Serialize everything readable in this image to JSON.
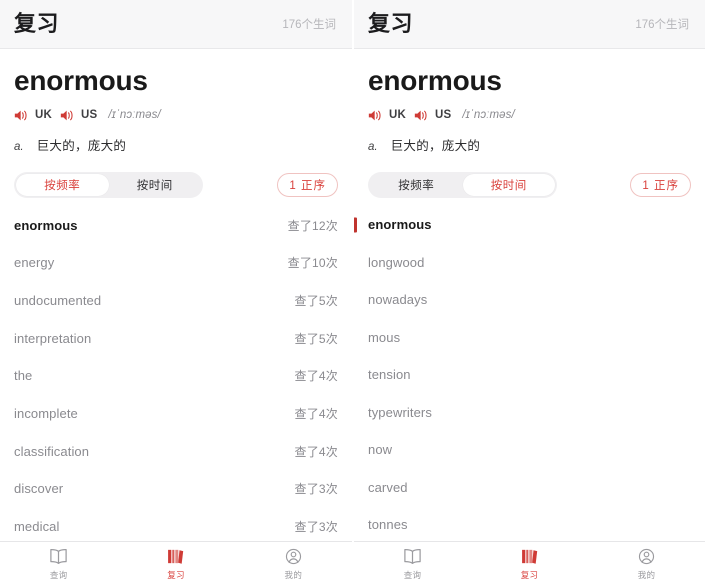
{
  "colors": {
    "accent_red": "#d9413c",
    "icon_red": "#cf3b36",
    "header_bg": "#f7f7f8",
    "muted_text": "#8a8a8f",
    "primary_text": "#1a1a1a"
  },
  "panels": [
    {
      "id": "left",
      "header": {
        "title": "复习",
        "count": "176个生词"
      },
      "word_card": {
        "headword": "enormous",
        "uk_label": "UK",
        "us_label": "US",
        "ipa": "/ɪˈnɔːməs/",
        "pos": "a.",
        "definition": "巨大的，庞大的",
        "uk_speaker_icon": "speaker-icon",
        "us_speaker_icon": "speaker-icon"
      },
      "controls": {
        "segments": [
          {
            "label": "按频率",
            "active": true
          },
          {
            "label": "按时间",
            "active": false
          }
        ],
        "order_pill": "1 正序"
      },
      "list": {
        "show_counts": true,
        "items": [
          {
            "word": "enormous",
            "count": "查了12次",
            "current": true,
            "marked": false
          },
          {
            "word": "energy",
            "count": "查了10次",
            "current": false,
            "marked": false
          },
          {
            "word": "undocumented",
            "count": "查了5次",
            "current": false,
            "marked": false
          },
          {
            "word": "interpretation",
            "count": "查了5次",
            "current": false,
            "marked": false
          },
          {
            "word": "the",
            "count": "查了4次",
            "current": false,
            "marked": false
          },
          {
            "word": "incomplete",
            "count": "查了4次",
            "current": false,
            "marked": false
          },
          {
            "word": "classification",
            "count": "查了4次",
            "current": false,
            "marked": false
          },
          {
            "word": "discover",
            "count": "查了3次",
            "current": false,
            "marked": false
          },
          {
            "word": "medical",
            "count": "查了3次",
            "current": false,
            "marked": false
          }
        ]
      },
      "tabbar": [
        {
          "label": "查询",
          "icon": "book-open-icon",
          "active": false
        },
        {
          "label": "复习",
          "icon": "books-shelf-icon",
          "active": true
        },
        {
          "label": "我的",
          "icon": "person-circle-icon",
          "active": false
        }
      ]
    },
    {
      "id": "right",
      "header": {
        "title": "复习",
        "count": "176个生词"
      },
      "word_card": {
        "headword": "enormous",
        "uk_label": "UK",
        "us_label": "US",
        "ipa": "/ɪˈnɔːməs/",
        "pos": "a.",
        "definition": "巨大的，庞大的",
        "uk_speaker_icon": "speaker-icon",
        "us_speaker_icon": "speaker-icon"
      },
      "controls": {
        "segments": [
          {
            "label": "按频率",
            "active": false
          },
          {
            "label": "按时间",
            "active": true
          }
        ],
        "order_pill": "1 正序"
      },
      "list": {
        "show_counts": false,
        "items": [
          {
            "word": "enormous",
            "count": "",
            "current": true,
            "marked": true
          },
          {
            "word": "longwood",
            "count": "",
            "current": false,
            "marked": false
          },
          {
            "word": "nowadays",
            "count": "",
            "current": false,
            "marked": false
          },
          {
            "word": "mous",
            "count": "",
            "current": false,
            "marked": false
          },
          {
            "word": "tension",
            "count": "",
            "current": false,
            "marked": false
          },
          {
            "word": "typewriters",
            "count": "",
            "current": false,
            "marked": false
          },
          {
            "word": "now",
            "count": "",
            "current": false,
            "marked": false
          },
          {
            "word": "carved",
            "count": "",
            "current": false,
            "marked": false
          },
          {
            "word": "tonnes",
            "count": "",
            "current": false,
            "marked": false
          }
        ]
      },
      "tabbar": [
        {
          "label": "查询",
          "icon": "book-open-icon",
          "active": false
        },
        {
          "label": "复习",
          "icon": "books-shelf-icon",
          "active": true
        },
        {
          "label": "我的",
          "icon": "person-circle-icon",
          "active": false
        }
      ]
    }
  ]
}
